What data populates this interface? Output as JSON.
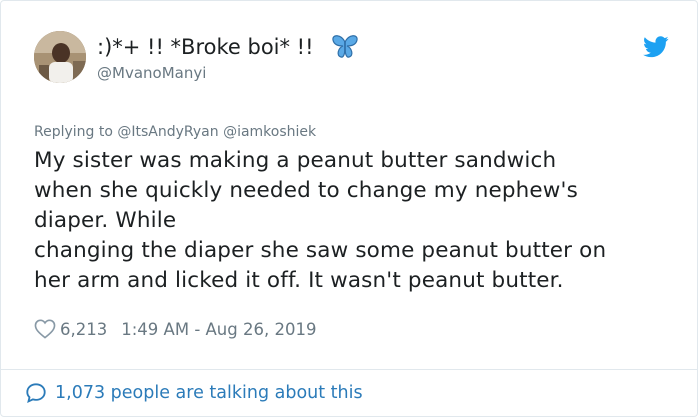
{
  "author": {
    "display_name": ":)*+ !! *Broke boi* !!",
    "handle": "@MvanoManyi",
    "avatar_icon": "profile-photo",
    "emoji_icon": "blue-butterfly-icon"
  },
  "brand_icon": "twitter-bird-icon",
  "colors": {
    "accent": "#1da1f2",
    "link": "#2b7bb9",
    "secondary_text": "#697882",
    "primary_text": "#1c2022",
    "border": "#e1e8ed"
  },
  "reply": {
    "prefix": "Replying to",
    "mentions": "@ItsAndyRyan @iamkoshiek"
  },
  "tweet": {
    "text": "My sister was making a peanut butter sandwich\nwhen she quickly needed to change my nephew's\ndiaper. While\nchanging the diaper she saw some peanut butter on\nher arm and licked it off. It wasn't peanut butter.",
    "likes": "6,213",
    "timestamp": "1:49 AM - Aug 26, 2019"
  },
  "footer": {
    "talking_text": "1,073 people are talking about this"
  }
}
